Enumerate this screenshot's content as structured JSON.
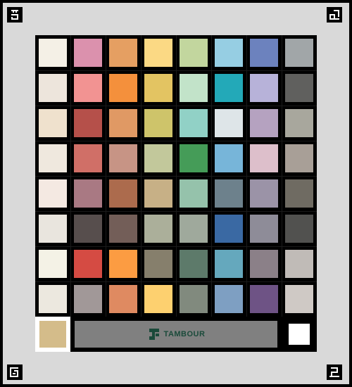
{
  "brand": {
    "name": "TAMBOUR",
    "bar_color": "#808080",
    "logo_color": "#1a4a3a"
  },
  "reference_swatch": {
    "color": "#d4bc8a"
  },
  "white_reference": {
    "color": "#ffffff"
  },
  "swatch_colors": [
    [
      "#f4f0e6",
      "#db91ad",
      "#e59f62",
      "#fbd984",
      "#c2d69e",
      "#96cee3",
      "#6c82be",
      "#a1a6a8"
    ],
    [
      "#ede5dc",
      "#f29392",
      "#f4903c",
      "#e3c462",
      "#c2e3c9",
      "#23a9b8",
      "#b7b2d9",
      "#60605e"
    ],
    [
      "#efe1cd",
      "#b5504a",
      "#e09964",
      "#cec46a",
      "#91d1c6",
      "#dee5e8",
      "#b5a2c0",
      "#a8a79d"
    ],
    [
      "#efe8de",
      "#d06f67",
      "#c79485",
      "#c2c89b",
      "#459c58",
      "#77b5d9",
      "#ddbfcb",
      "#a89f97"
    ],
    [
      "#f4e9e2",
      "#a97983",
      "#ac6b4d",
      "#c7b086",
      "#95c2ab",
      "#6d818c",
      "#9b93a7",
      "#6f6b62"
    ],
    [
      "#e9e5de",
      "#574e4d",
      "#735e58",
      "#abaf9a",
      "#9fa99c",
      "#3a69a3",
      "#8e8c98",
      "#51514f"
    ],
    [
      "#f4f2e6",
      "#d54b43",
      "#fc9c42",
      "#867f6c",
      "#5d7a6a",
      "#65a8bd",
      "#8b8088",
      "#c0bbb7"
    ],
    [
      "#ece8df",
      "#a19898",
      "#df8a61",
      "#fdd06f",
      "#818a7e",
      "#7e9fc2",
      "#6e5385",
      "#cfc9c5"
    ]
  ]
}
